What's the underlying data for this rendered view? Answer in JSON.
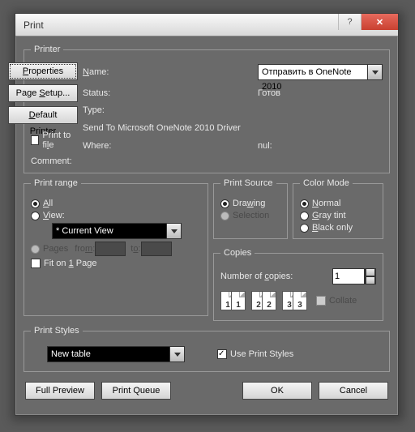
{
  "window": {
    "title": "Print"
  },
  "printer": {
    "legend": "Printer",
    "name_label_u": "N",
    "name_label_rest": "ame:",
    "name_value": "Отправить в OneNote 2010",
    "status_label": "Status:",
    "status_value": "Готов",
    "type_label": "Type:",
    "type_value": "Send To Microsoft OneNote 2010 Driver",
    "where_label": "Where:",
    "where_value": "nul:",
    "comment_label": "Comment:",
    "btn_properties_u": "P",
    "btn_properties_rest": "roperties",
    "btn_pagesetup": "Page ",
    "btn_pagesetup_u": "S",
    "btn_pagesetup_rest": "etup...",
    "btn_default_u": "D",
    "btn_default_rest": "efault Printer",
    "chk_printfile": "Print to fi",
    "chk_printfile_u": "l",
    "chk_printfile_rest": "e"
  },
  "range": {
    "legend": "Print range",
    "all_u": "A",
    "all_rest": "ll",
    "view_u": "V",
    "view_rest": "iew:",
    "view_value": "* Current View",
    "pages": "Pages",
    "from_pre": "fro",
    "from_u": "m",
    "from_rest": ":",
    "to_pre": "t",
    "to_u": "o",
    "to_rest": ":",
    "fit_pre": "Fit on ",
    "fit_u": "1",
    "fit_rest": " Page"
  },
  "source": {
    "legend": "Print Source",
    "drawing": "Dra",
    "drawing_u": "w",
    "drawing_rest": "ing",
    "selection": "Selection"
  },
  "color": {
    "legend": "Color Mode",
    "normal_u": "N",
    "normal_rest": "ormal",
    "gray_u": "G",
    "gray_rest": "ray tint",
    "black_u": "B",
    "black_rest": "lack only"
  },
  "copies": {
    "legend": "Copies",
    "num_pre": "Number of ",
    "num_u": "c",
    "num_rest": "opies:",
    "num_value": "1",
    "collate": "Collate",
    "p1": "1",
    "p2": "2",
    "p3": "3"
  },
  "styles": {
    "legend": "Print Styles",
    "value": "New table",
    "use": "Use Print Styles"
  },
  "bottom": {
    "full_preview": "Full Preview",
    "print_queue": "Print Queue",
    "ok": "OK",
    "cancel": "Cancel"
  }
}
